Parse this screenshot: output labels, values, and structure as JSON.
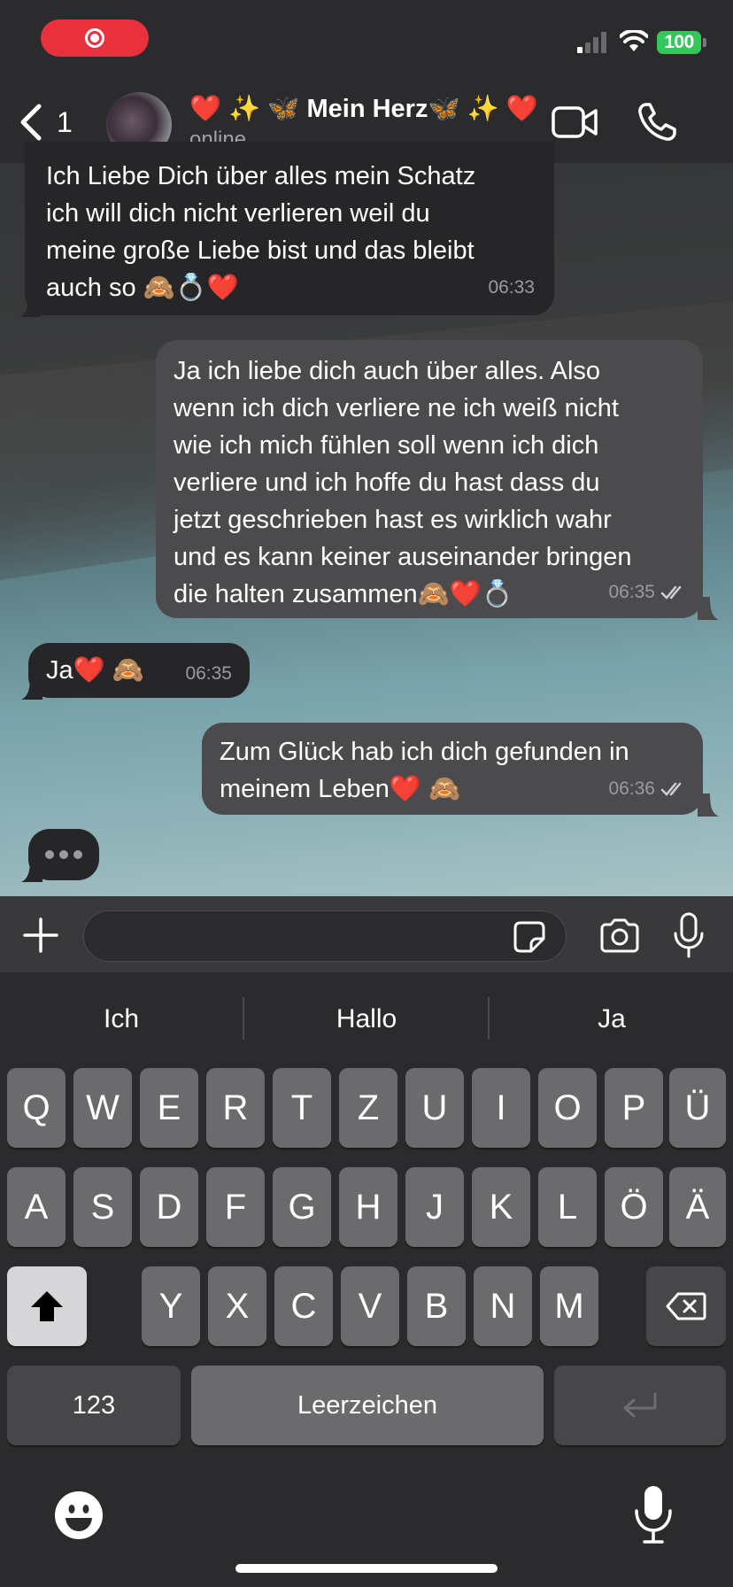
{
  "status_bar": {
    "battery": "100",
    "colors": {
      "record": "#e8313c",
      "battery": "#34c759"
    }
  },
  "header": {
    "back_count": "1",
    "contact_name": "❤️ ✨ 🦋 Mein Herz🦋 ✨ ❤️",
    "contact_status": "online"
  },
  "messages": [
    {
      "direction": "incoming",
      "text": "Ich Liebe Dich über alles mein Schatz\nich will dich nicht verlieren weil du\nmeine große Liebe bist und das bleibt\nauch so 🙈💍❤️",
      "time": "06:33"
    },
    {
      "direction": "outgoing",
      "text": "Ja ich liebe dich auch über alles. Also\nwenn ich dich verliere ne ich weiß nicht\nwie ich mich fühlen soll wenn ich dich\nverliere und ich hoffe du hast dass du\njetzt geschrieben hast es wirklich wahr\nund es kann keiner auseinander bringen\ndie halten zusammen🙈❤️💍",
      "time": "06:35",
      "status": "read"
    },
    {
      "direction": "incoming",
      "text": "Ja❤️ 🙈",
      "time": "06:35"
    },
    {
      "direction": "outgoing",
      "text": "Zum Glück hab ich dich gefunden in\nmeinem Leben❤️ 🙈",
      "time": "06:36",
      "status": "read"
    }
  ],
  "input": {
    "value": ""
  },
  "keyboard": {
    "suggestions": [
      "Ich",
      "Hallo",
      "Ja"
    ],
    "row1": [
      "Q",
      "W",
      "E",
      "R",
      "T",
      "Z",
      "U",
      "I",
      "O",
      "P",
      "Ü"
    ],
    "row2": [
      "A",
      "S",
      "D",
      "F",
      "G",
      "H",
      "J",
      "K",
      "L",
      "Ö",
      "Ä"
    ],
    "row3": [
      "Y",
      "X",
      "C",
      "V",
      "B",
      "N",
      "M"
    ],
    "numbers_key": "123",
    "space_key": "Leerzeichen"
  }
}
